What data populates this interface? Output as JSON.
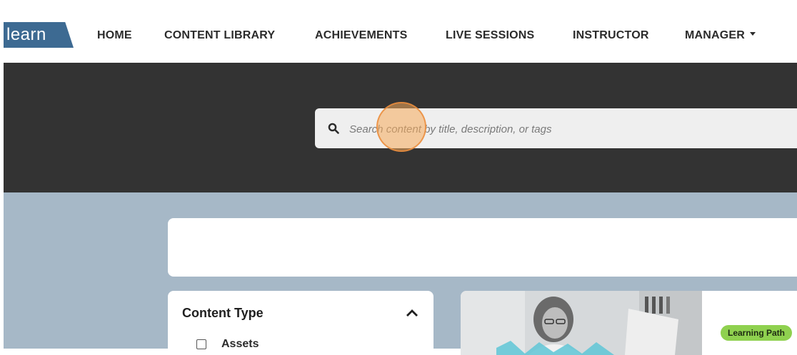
{
  "brand": {
    "logo_text": "learn",
    "accent": "#3d6a92"
  },
  "nav": {
    "items": [
      {
        "label": "HOME"
      },
      {
        "label": "CONTENT LIBRARY"
      },
      {
        "label": "ACHIEVEMENTS"
      },
      {
        "label": "LIVE SESSIONS"
      },
      {
        "label": "INSTRUCTOR"
      },
      {
        "label": "MANAGER"
      }
    ],
    "manager_has_dropdown": true
  },
  "search": {
    "placeholder": "Search content by title, description, or tags",
    "value": "",
    "icon": "magnifier-icon"
  },
  "filters": {
    "section_title": "Content Type",
    "collapse_icon": "chevron-up-icon",
    "options": [
      {
        "label": "Assets",
        "checked": false
      }
    ]
  },
  "card": {
    "badge": "Learning Path",
    "badge_color": "#8fd14f"
  },
  "colors": {
    "hero": "#333333",
    "content_background": "#a6b8c7"
  }
}
